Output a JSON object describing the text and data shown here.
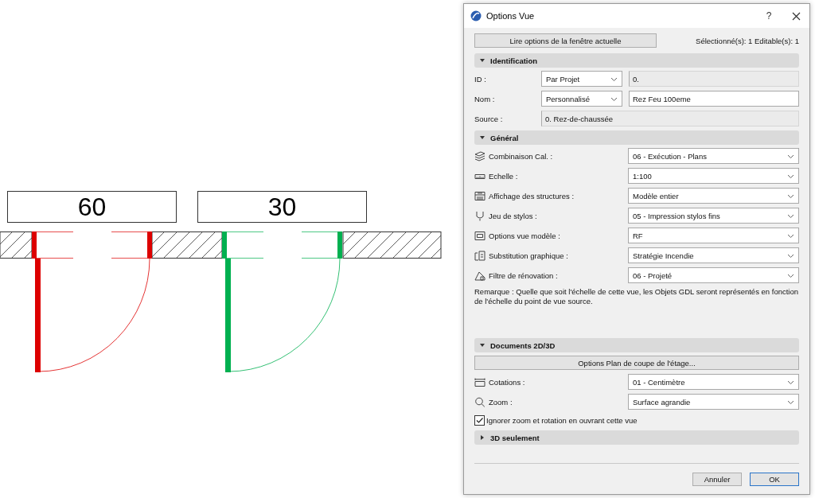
{
  "plan": {
    "doors": [
      {
        "label": "60",
        "color": "#dd0000"
      },
      {
        "label": "30",
        "color": "#00b050"
      }
    ]
  },
  "dialog": {
    "title": "Options Vue",
    "help": "?",
    "read_button": "Lire options de la fenêtre actuelle",
    "selection_info": "Sélectionné(s): 1 Editable(s): 1",
    "sections": [
      {
        "title": "Identification",
        "expanded": true,
        "rows": [
          {
            "kind": "combo",
            "label": "ID :",
            "select": "Par Projet",
            "value": "0.",
            "editable": false
          },
          {
            "kind": "combo",
            "label": "Nom :",
            "select": "Personnalisé",
            "value": "Rez Feu 100eme",
            "editable": true
          },
          {
            "kind": "field",
            "label": "Source :",
            "value": "0. Rez-de-chaussée",
            "editable": false
          }
        ]
      },
      {
        "title": "Général",
        "expanded": true,
        "rows": [
          {
            "kind": "select",
            "label": "Combinaison Cal. :",
            "value": "06 - Exécution - Plans"
          },
          {
            "kind": "select",
            "label": "Echelle :",
            "value": "1:100"
          },
          {
            "kind": "select",
            "label": "Affichage des structures :",
            "value": "Modèle entier"
          },
          {
            "kind": "select",
            "label": "Jeu de stylos :",
            "value": "05 - Impression stylos fins"
          },
          {
            "kind": "select",
            "label": "Options vue modèle :",
            "value": "RF"
          },
          {
            "kind": "select",
            "label": "Substitution graphique :",
            "value": "Stratégie Incendie"
          },
          {
            "kind": "select",
            "label": "Filtre de rénovation :",
            "value": "06 - Projeté"
          },
          {
            "kind": "note",
            "text": "Remarque : Quelle que soit l'échelle de cette vue, les Objets GDL seront représentés en fonction de l'échelle du point de vue source."
          }
        ]
      },
      {
        "title": "Documents 2D/3D",
        "expanded": true,
        "rows": [
          {
            "kind": "button",
            "label": "Options Plan de coupe de l'étage..."
          },
          {
            "kind": "select",
            "label": "Cotations :",
            "value": "01 - Centimètre"
          },
          {
            "kind": "select",
            "label": "Zoom :",
            "value": "Surface agrandie"
          },
          {
            "kind": "checkbox",
            "label": "Ignorer zoom et rotation en ouvrant cette vue",
            "checked": true
          }
        ]
      },
      {
        "title": "3D seulement",
        "expanded": false
      }
    ],
    "buttons": [
      {
        "label": "Annuler",
        "default": false
      },
      {
        "label": "OK",
        "default": true
      }
    ]
  }
}
